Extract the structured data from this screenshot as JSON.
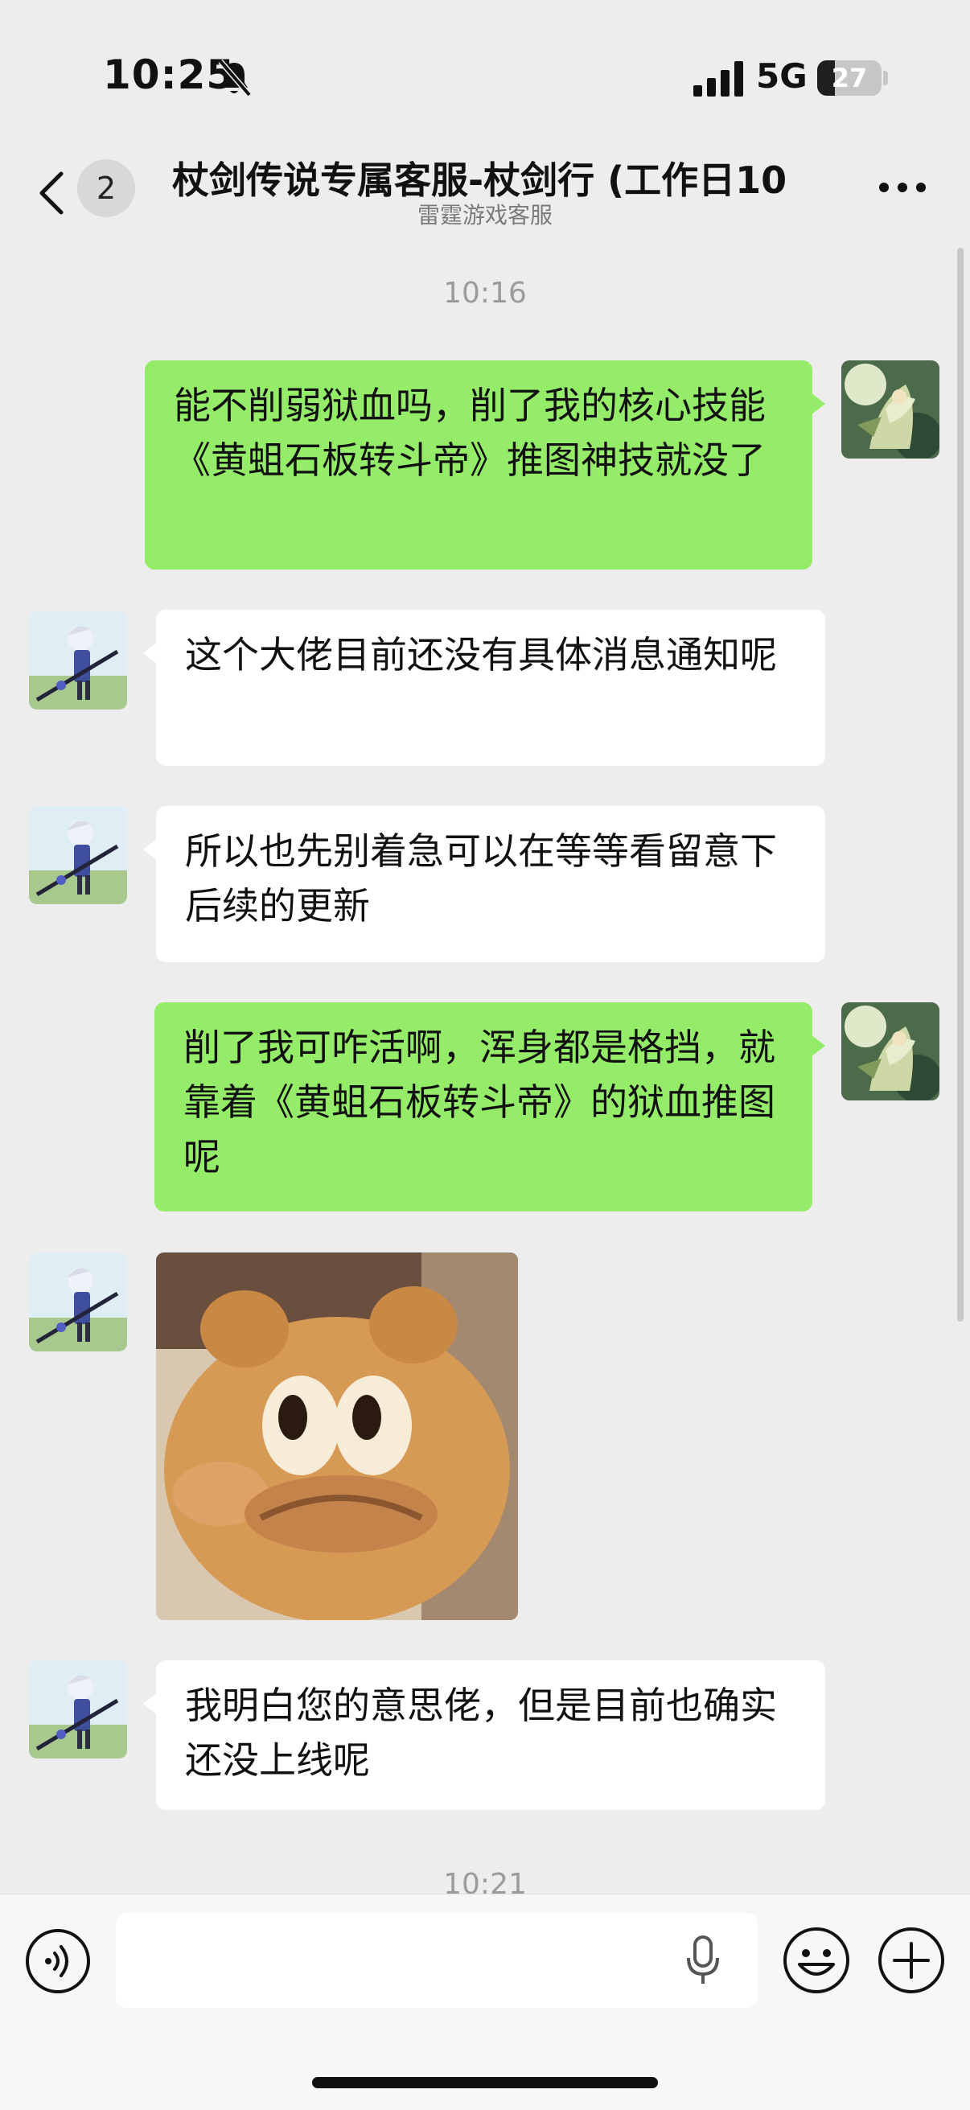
{
  "status_bar": {
    "time": "10:25",
    "network": "5G",
    "battery": "27",
    "battery_level": 0.27
  },
  "header": {
    "unread_count": "2",
    "title": "杖剑传说专属客服-杖剑行 (工作日10",
    "subtitle": "雷霆游戏客服"
  },
  "chat": {
    "timestamp_1": "10:16",
    "messages": [
      {
        "from": "me",
        "text": "能不削弱狱血吗，削了我的核心技能《黄蛆石板转斗帝》推图神技就没了"
      },
      {
        "from": "agent",
        "text": "这个大佬目前还没有具体消息通知呢"
      },
      {
        "from": "agent",
        "text": "所以也先别着急可以在等等看留意下后续的更新"
      },
      {
        "from": "me",
        "text": "削了我可咋活啊，浑身都是格挡，就靠着《黄蛆石板转斗帝》的狱血推图呢"
      },
      {
        "from": "agent",
        "type": "sticker"
      },
      {
        "from": "agent",
        "text": "我明白您的意思佬，但是目前也确实还没上线呢"
      }
    ],
    "timestamp_2": "10:21"
  },
  "input_bar": {
    "placeholder": ""
  },
  "colors": {
    "my_bubble": "#95ec69",
    "agent_bubble": "#ffffff",
    "background": "#ededed"
  }
}
